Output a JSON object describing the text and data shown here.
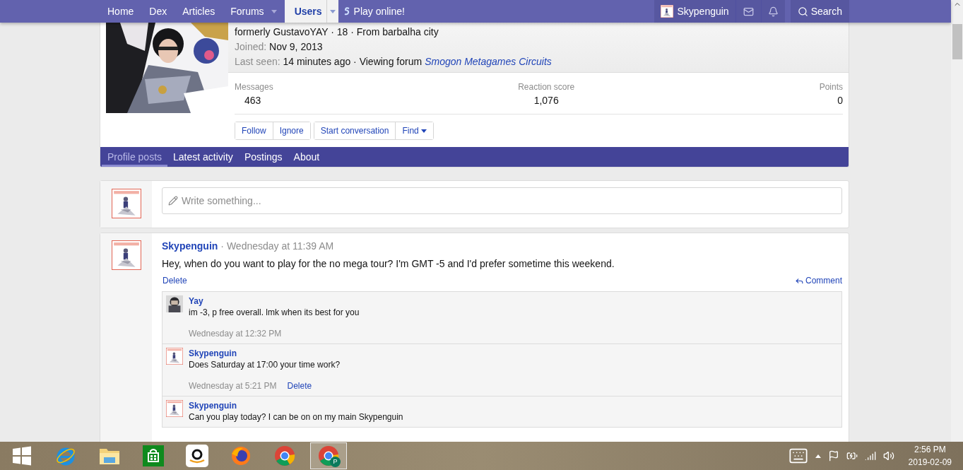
{
  "nav": {
    "items": [
      {
        "label": "Home",
        "selected": false,
        "dropdown": false
      },
      {
        "label": "Dex",
        "selected": false,
        "dropdown": false
      },
      {
        "label": "Articles",
        "selected": false,
        "dropdown": false
      },
      {
        "label": "Forums",
        "selected": false,
        "dropdown": true
      },
      {
        "label": "Users",
        "selected": true,
        "dropdown": true
      }
    ],
    "play": "Play online!",
    "user": "Skypenguin",
    "search": "Search"
  },
  "profile": {
    "tagline": "formerly GustavoYAY · 18 · From barbalha city",
    "joined_label": "Joined:",
    "joined": "Nov 9, 2013",
    "seen_label": "Last seen:",
    "seen": "14 minutes ago · Viewing forum",
    "seen_link": "Smogon Metagames Circuits",
    "stats": [
      {
        "label": "Messages",
        "value": "463"
      },
      {
        "label": "Reaction score",
        "value": "1,076"
      },
      {
        "label": "Points",
        "value": "0"
      }
    ],
    "button_groups": [
      [
        "Follow",
        "Ignore"
      ],
      [
        "Start conversation",
        "Find"
      ]
    ]
  },
  "tabs": [
    {
      "label": "Profile posts",
      "selected": true
    },
    {
      "label": "Latest activity",
      "selected": false
    },
    {
      "label": "Postings",
      "selected": false
    },
    {
      "label": "About",
      "selected": false
    }
  ],
  "composer": {
    "placeholder": "Write something..."
  },
  "post": {
    "author": "Skypenguin",
    "time": "· Wednesday at 11:39 AM",
    "text": "Hey, when do you want to play for the no mega tour? I'm GMT -5 and I'd prefer sometime this weekend.",
    "delete": "Delete",
    "comment": "Comment",
    "comments": [
      {
        "author": "Yay",
        "text": "im -3, p free overall. lmk when its best for you",
        "time": "Wednesday at 12:32 PM"
      },
      {
        "author": "Skypenguin",
        "text": "Does Saturday at 17:00 your time work?",
        "time": "Wednesday at 5:21 PM",
        "delete": "Delete"
      },
      {
        "author": "Skypenguin",
        "text": "Can you play today? I can be on on my main Skypenguin"
      }
    ]
  },
  "taskbar": {
    "apps": [
      {
        "kind": "start"
      },
      {
        "kind": "ie"
      },
      {
        "kind": "explorer"
      },
      {
        "kind": "store"
      },
      {
        "kind": "amazon"
      },
      {
        "kind": "firefox"
      },
      {
        "kind": "chrome"
      },
      {
        "kind": "chrome-profile"
      }
    ],
    "badge": "P",
    "time": "2:56 PM",
    "date": "2019-02-09"
  }
}
